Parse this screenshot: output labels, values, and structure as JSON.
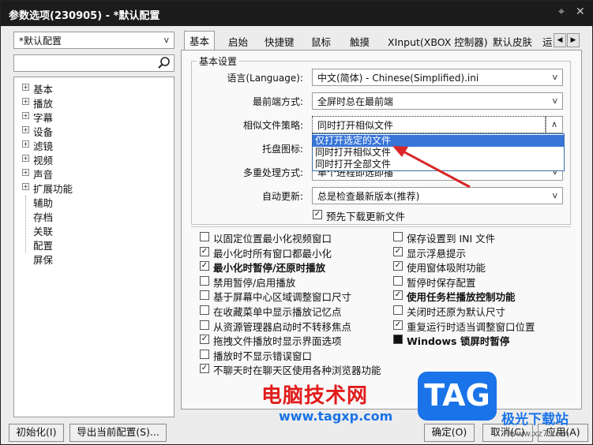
{
  "window": {
    "title": "参数选项(230905) - *默认配置"
  },
  "titlebar": {
    "pin_glyph": "⌖",
    "close_glyph": "✕"
  },
  "profile_select": {
    "value": "*默认配置"
  },
  "search": {
    "value": ""
  },
  "tree": [
    {
      "label": "基本",
      "expandable": true
    },
    {
      "label": "播放",
      "expandable": true
    },
    {
      "label": "字幕",
      "expandable": true
    },
    {
      "label": "设备",
      "expandable": true
    },
    {
      "label": "滤镜",
      "expandable": true
    },
    {
      "label": "视频",
      "expandable": true
    },
    {
      "label": "声音",
      "expandable": true
    },
    {
      "label": "扩展功能",
      "expandable": true
    },
    {
      "label": "辅助",
      "expandable": false
    },
    {
      "label": "存档",
      "expandable": false
    },
    {
      "label": "关联",
      "expandable": false
    },
    {
      "label": "配置",
      "expandable": false
    },
    {
      "label": "屏保",
      "expandable": false
    }
  ],
  "tabs": [
    "基本",
    "启始",
    "快捷键",
    "鼠标",
    "触摸",
    "XInput(XBOX 控制器)",
    "默认皮肤",
    "运"
  ],
  "basic": {
    "group_title": "基本设置",
    "language_label": "语言(Language):",
    "language_value": "中文(简体) - Chinese(Simplified).ini",
    "topmost_label": "最前端方式:",
    "topmost_value": "全屏时总在最前端",
    "similar_label": "相似文件策略:",
    "similar_value": "同时打开相似文件",
    "tray_label": "托盘图标:",
    "multi_label": "多重处理方式:",
    "multi_value": "单个进程即选即播",
    "update_label": "自动更新:",
    "update_value": "总是检查最新版本(推荐)",
    "predownload_label": "预先下载更新文件"
  },
  "similar_options": [
    "仅打开选定的文件",
    "同时打开相似文件",
    "同时打开全部文件"
  ],
  "options_left": [
    {
      "label": "以固定位置最小化视频窗口",
      "checked": false,
      "bold": false
    },
    {
      "label": "最小化时所有窗口都最小化",
      "checked": true,
      "bold": false
    },
    {
      "label": "最小化时暂停/还原时播放",
      "checked": true,
      "bold": true
    },
    {
      "label": "禁用暂停/启用播放",
      "checked": false,
      "bold": false
    },
    {
      "label": "基于屏幕中心区域调整窗口尺寸",
      "checked": false,
      "bold": false
    },
    {
      "label": "在收藏菜单中显示播放记忆点",
      "checked": false,
      "bold": false
    },
    {
      "label": "从资源管理器启动时不转移焦点",
      "checked": false,
      "bold": false
    },
    {
      "label": "拖拽文件播放时显示界面选项",
      "checked": true,
      "bold": false
    },
    {
      "label": "播放时不显示错误窗口",
      "checked": false,
      "bold": false
    },
    {
      "label": "不聊天时在聊天区使用各种浏览器功能",
      "checked": true,
      "bold": false
    }
  ],
  "options_right": [
    {
      "label": "保存设置到 INI 文件",
      "checked": false,
      "bold": false,
      "filled": false
    },
    {
      "label": "显示浮悬提示",
      "checked": true,
      "bold": false,
      "filled": false
    },
    {
      "label": "使用窗体吸附功能",
      "checked": true,
      "bold": false,
      "filled": false
    },
    {
      "label": "暂停时保存配置",
      "checked": false,
      "bold": false,
      "filled": false
    },
    {
      "label": "使用任务栏播放控制功能",
      "checked": true,
      "bold": true,
      "filled": false
    },
    {
      "label": "关闭时还原为默认尺寸",
      "checked": false,
      "bold": false,
      "filled": false
    },
    {
      "label": "重复运行时适当调整窗口位置",
      "checked": true,
      "bold": false,
      "filled": false
    },
    {
      "label": "Windows 锁屏时暂停",
      "checked": false,
      "bold": true,
      "filled": true
    }
  ],
  "buttons": {
    "init": "初始化(I)",
    "export": "导出当前配置(S)...",
    "ok": "确定(O)",
    "cancel": "取消(C)",
    "apply": "应用(A)"
  },
  "watermark": {
    "site_name": "电脑技术网",
    "site_url": "www.tagxp.com",
    "logo_text": "TAG",
    "right_name": "极光下载站",
    "right_url": "www.xz7.com"
  },
  "colors": {
    "watermark_red": "#e11c1c",
    "watermark_blue": "#1a73e8",
    "arrow_red": "#d9262a",
    "selection_blue": "#3875d7"
  }
}
